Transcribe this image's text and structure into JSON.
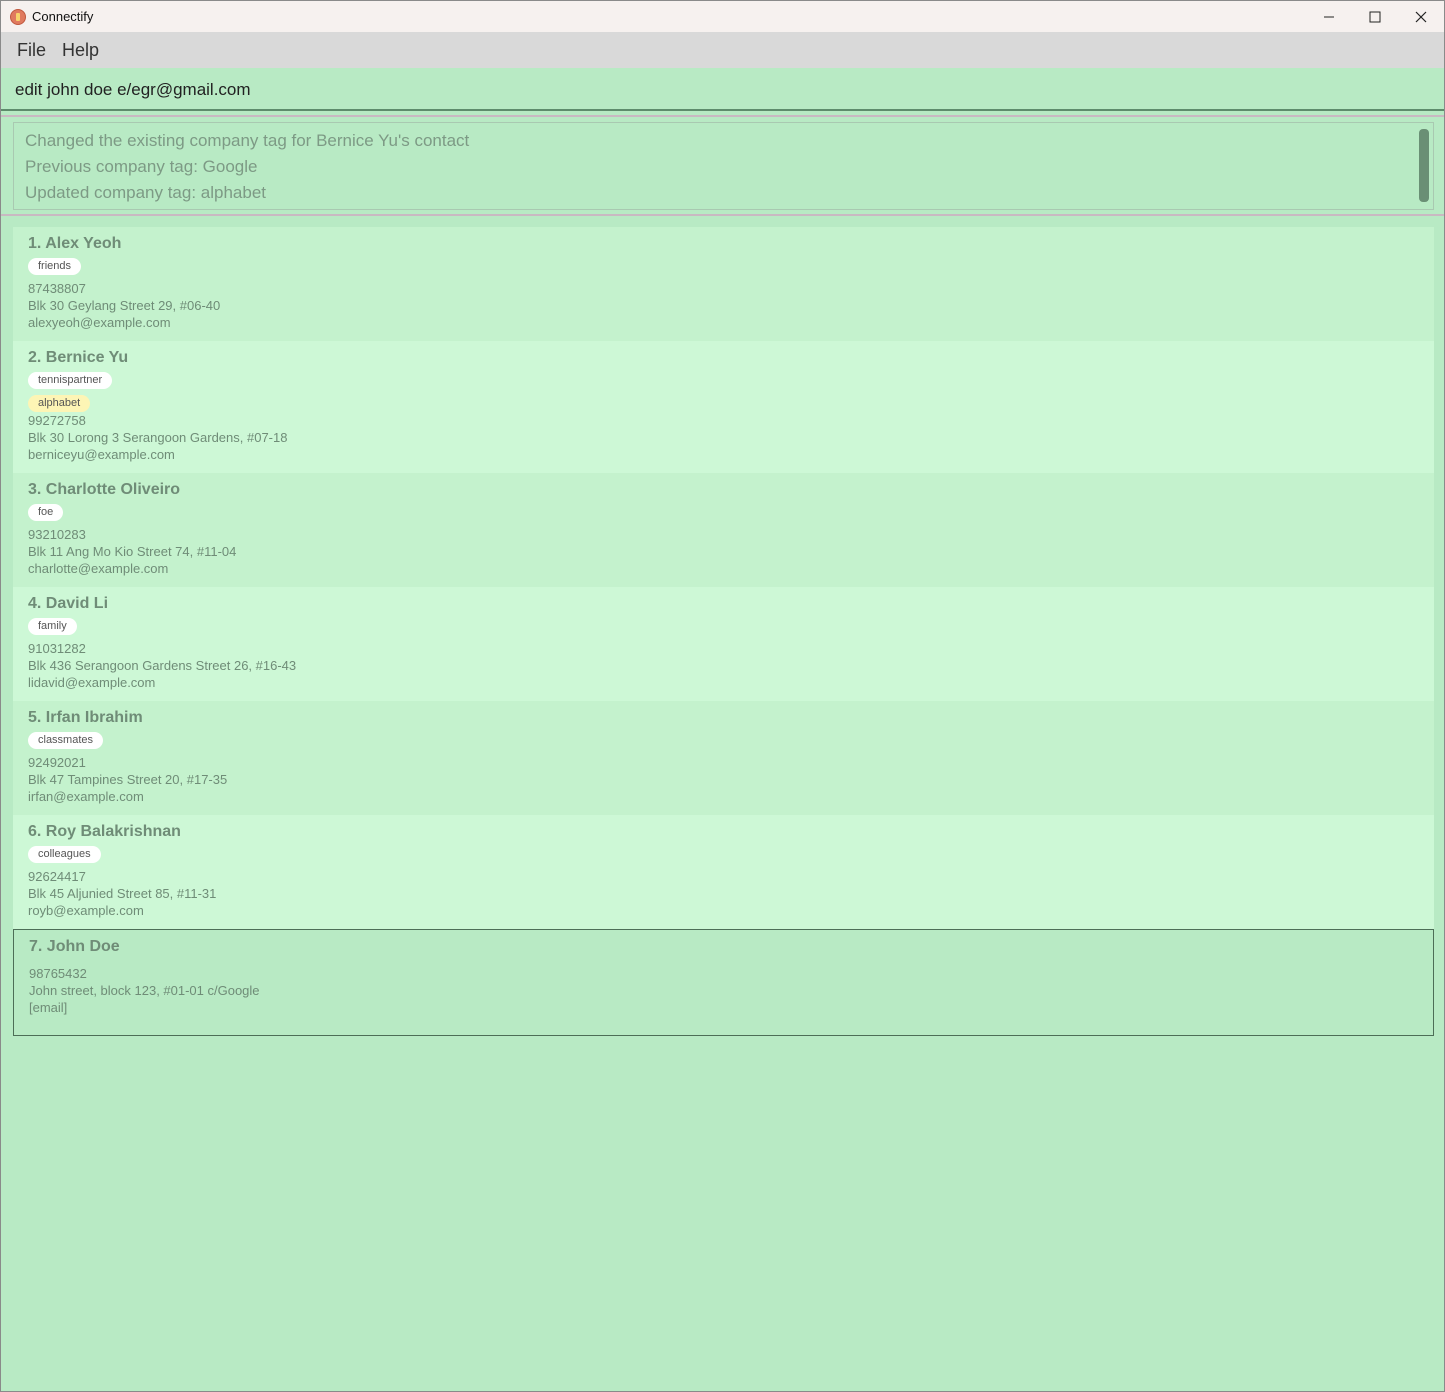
{
  "window": {
    "title": "Connectify"
  },
  "menu": {
    "file": "File",
    "help": "Help"
  },
  "command": {
    "value": "edit john doe e/egr@gmail.com"
  },
  "result": {
    "lines": [
      "Changed the existing company tag for Bernice Yu's contact",
      "Previous company tag: Google",
      "Updated company tag: alphabet"
    ]
  },
  "persons": [
    {
      "name": "1.  Alex Yeoh",
      "tags": [
        "friends"
      ],
      "company": "",
      "phone": "87438807",
      "address": "Blk 30 Geylang Street 29, #06-40",
      "email": "alexyeoh@example.com"
    },
    {
      "name": "2.  Bernice Yu",
      "tags": [
        "tennispartner"
      ],
      "company": "alphabet",
      "phone": "99272758",
      "address": "Blk 30 Lorong 3 Serangoon Gardens, #07-18",
      "email": "berniceyu@example.com"
    },
    {
      "name": "3.  Charlotte Oliveiro",
      "tags": [
        "foe"
      ],
      "company": "",
      "phone": "93210283",
      "address": "Blk 11 Ang Mo Kio Street 74, #11-04",
      "email": "charlotte@example.com"
    },
    {
      "name": "4.  David Li",
      "tags": [
        "family"
      ],
      "company": "",
      "phone": "91031282",
      "address": "Blk 436 Serangoon Gardens Street 26, #16-43",
      "email": "lidavid@example.com"
    },
    {
      "name": "5.  Irfan Ibrahim",
      "tags": [
        "classmates"
      ],
      "company": "",
      "phone": "92492021",
      "address": "Blk 47 Tampines Street 20, #17-35",
      "email": "irfan@example.com"
    },
    {
      "name": "6.  Roy Balakrishnan",
      "tags": [
        "colleagues"
      ],
      "company": "",
      "phone": "92624417",
      "address": "Blk 45 Aljunied Street 85, #11-31",
      "email": "royb@example.com"
    },
    {
      "name": "7.  John Doe",
      "tags": [],
      "company": "",
      "phone": "98765432",
      "address": "John street, block 123, #01-01 c/Google",
      "email": "[email]"
    }
  ]
}
